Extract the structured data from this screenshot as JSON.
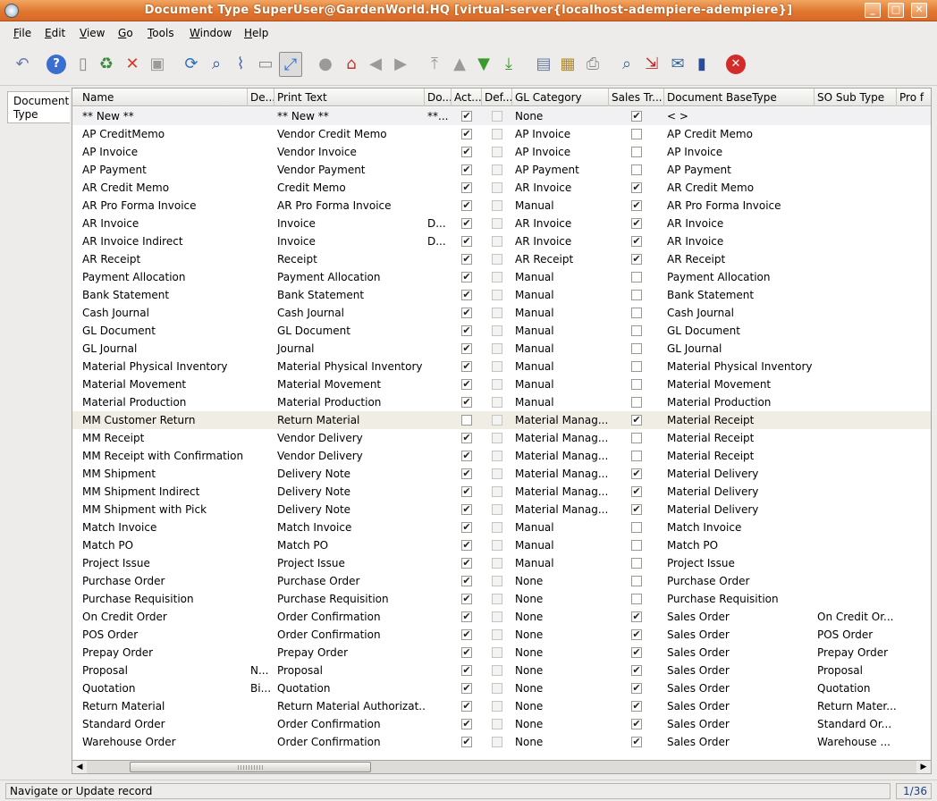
{
  "window": {
    "title": "Document Type  SuperUser@GardenWorld.HQ [virtual-server{localhost-adempiere-adempiere}]"
  },
  "menu": [
    "File",
    "Edit",
    "View",
    "Go",
    "Tools",
    "Window",
    "Help"
  ],
  "toolbar": [
    {
      "name": "undo-icon",
      "glyph": "↶",
      "color": "#6b7aa8"
    },
    {
      "name": "help-icon",
      "glyph": "?",
      "color": "#3a6ecf",
      "circle": true
    },
    {
      "name": "new-record-icon",
      "glyph": "▯",
      "color": "#888"
    },
    {
      "name": "copy-record-icon",
      "glyph": "♻",
      "color": "#3a8a3a"
    },
    {
      "name": "delete-icon",
      "glyph": "✕",
      "color": "#d13a2a"
    },
    {
      "name": "save-icon",
      "glyph": "▣",
      "color": "#9a9a9a"
    },
    {
      "name": "refresh-icon",
      "glyph": "⟳",
      "color": "#2a6fbf"
    },
    {
      "name": "find-icon",
      "glyph": "⌕",
      "color": "#2a5aa0"
    },
    {
      "name": "attachment-icon",
      "glyph": "⌇",
      "color": "#4a6ab0"
    },
    {
      "name": "chat-icon",
      "glyph": "▭",
      "color": "#888"
    },
    {
      "name": "grid-toggle-icon",
      "glyph": "⤢",
      "color": "#3a6ecf",
      "active": true
    },
    {
      "name": "history-icon",
      "glyph": "●",
      "color": "#9a9a9a"
    },
    {
      "name": "home-icon",
      "glyph": "⌂",
      "color": "#c0392b"
    },
    {
      "name": "parent-icon",
      "glyph": "◀",
      "color": "#9a9a9a"
    },
    {
      "name": "detail-icon",
      "glyph": "▶",
      "color": "#9a9a9a"
    },
    {
      "name": "first-record-icon",
      "glyph": "⤒",
      "color": "#9a9a9a"
    },
    {
      "name": "previous-record-icon",
      "glyph": "▲",
      "color": "#9a9a9a"
    },
    {
      "name": "next-record-icon",
      "glyph": "▼",
      "color": "#3a9a2a"
    },
    {
      "name": "last-record-icon",
      "glyph": "⤓",
      "color": "#3a9a2a"
    },
    {
      "name": "report-icon",
      "glyph": "▤",
      "color": "#6a7a9a"
    },
    {
      "name": "archive-icon",
      "glyph": "▦",
      "color": "#b08a2a"
    },
    {
      "name": "print-icon",
      "glyph": "⎙",
      "color": "#8a8a8a"
    },
    {
      "name": "zoom-across-icon",
      "glyph": "⌕",
      "color": "#3a6a9a"
    },
    {
      "name": "workflow-icon",
      "glyph": "⇲",
      "color": "#c02a2a"
    },
    {
      "name": "request-icon",
      "glyph": "✉",
      "color": "#3a6a9a"
    },
    {
      "name": "product-info-icon",
      "glyph": "▮",
      "color": "#2a4a9a"
    },
    {
      "name": "exit-icon",
      "glyph": "✕",
      "color": "#d32a2a",
      "circle": true
    }
  ],
  "tab": {
    "label": "Document Type"
  },
  "columns": [
    "Name",
    "De...",
    "Print Text",
    "Do...",
    "Act...",
    "Def...",
    "GL Category",
    "Sales Tr...",
    "Document BaseType",
    "SO Sub Type",
    "Pro f"
  ],
  "rows": [
    {
      "name": "** New **",
      "desc": "",
      "print": "** New **",
      "doc": "**...",
      "active": true,
      "def": false,
      "gl": "None",
      "sales": true,
      "base": "<  >",
      "sub": "",
      "new": true
    },
    {
      "name": "AP CreditMemo",
      "desc": "",
      "print": "Vendor Credit Memo",
      "doc": "",
      "active": true,
      "def": false,
      "gl": "AP Invoice",
      "sales": false,
      "base": "AP Credit Memo",
      "sub": ""
    },
    {
      "name": "AP Invoice",
      "desc": "",
      "print": "Vendor Invoice",
      "doc": "",
      "active": true,
      "def": false,
      "gl": "AP Invoice",
      "sales": false,
      "base": "AP Invoice",
      "sub": ""
    },
    {
      "name": "AP Payment",
      "desc": "",
      "print": "Vendor Payment",
      "doc": "",
      "active": true,
      "def": false,
      "gl": "AP Payment",
      "sales": false,
      "base": "AP Payment",
      "sub": ""
    },
    {
      "name": "AR Credit Memo",
      "desc": "",
      "print": "Credit Memo",
      "doc": "",
      "active": true,
      "def": false,
      "gl": "AR Invoice",
      "sales": true,
      "base": "AR Credit Memo",
      "sub": ""
    },
    {
      "name": "AR Pro Forma Invoice",
      "desc": "",
      "print": "AR Pro Forma Invoice",
      "doc": "",
      "active": true,
      "def": false,
      "gl": "Manual",
      "sales": true,
      "base": "AR Pro Forma Invoice",
      "sub": ""
    },
    {
      "name": "AR Invoice",
      "desc": "",
      "print": "Invoice",
      "doc": "D...",
      "active": true,
      "def": false,
      "gl": "AR Invoice",
      "sales": true,
      "base": "AR Invoice",
      "sub": ""
    },
    {
      "name": "AR Invoice Indirect",
      "desc": "",
      "print": "Invoice",
      "doc": "D...",
      "active": true,
      "def": false,
      "gl": "AR Invoice",
      "sales": true,
      "base": "AR Invoice",
      "sub": ""
    },
    {
      "name": "AR Receipt",
      "desc": "",
      "print": "Receipt",
      "doc": "",
      "active": true,
      "def": false,
      "gl": "AR Receipt",
      "sales": true,
      "base": "AR Receipt",
      "sub": ""
    },
    {
      "name": "Payment Allocation",
      "desc": "",
      "print": "Payment Allocation",
      "doc": "",
      "active": true,
      "def": false,
      "gl": "Manual",
      "sales": false,
      "base": "Payment Allocation",
      "sub": ""
    },
    {
      "name": "Bank Statement",
      "desc": "",
      "print": "Bank Statement",
      "doc": "",
      "active": true,
      "def": false,
      "gl": "Manual",
      "sales": false,
      "base": "Bank Statement",
      "sub": ""
    },
    {
      "name": "Cash Journal",
      "desc": "",
      "print": "Cash Journal",
      "doc": "",
      "active": true,
      "def": false,
      "gl": "Manual",
      "sales": false,
      "base": "Cash Journal",
      "sub": ""
    },
    {
      "name": "GL Document",
      "desc": "",
      "print": "GL Document",
      "doc": "",
      "active": true,
      "def": false,
      "gl": "Manual",
      "sales": false,
      "base": "GL Document",
      "sub": ""
    },
    {
      "name": "GL Journal",
      "desc": "",
      "print": "Journal",
      "doc": "",
      "active": true,
      "def": false,
      "gl": "Manual",
      "sales": false,
      "base": "GL Journal",
      "sub": ""
    },
    {
      "name": "Material Physical Inventory",
      "desc": "",
      "print": "Material Physical Inventory",
      "doc": "",
      "active": true,
      "def": false,
      "gl": "Manual",
      "sales": false,
      "base": "Material Physical Inventory",
      "sub": ""
    },
    {
      "name": "Material Movement",
      "desc": "",
      "print": "Material Movement",
      "doc": "",
      "active": true,
      "def": false,
      "gl": "Manual",
      "sales": false,
      "base": "Material Movement",
      "sub": ""
    },
    {
      "name": "Material Production",
      "desc": "",
      "print": "Material Production",
      "doc": "",
      "active": true,
      "def": false,
      "gl": "Manual",
      "sales": false,
      "base": "Material Production",
      "sub": ""
    },
    {
      "name": "MM Customer Return",
      "desc": "",
      "print": "Return Material",
      "doc": "",
      "active": false,
      "def": false,
      "gl": "Material Manag...",
      "sales": true,
      "base": "Material Receipt",
      "sub": "",
      "selected": true
    },
    {
      "name": "MM Receipt",
      "desc": "",
      "print": "Vendor Delivery",
      "doc": "",
      "active": true,
      "def": false,
      "gl": "Material Manag...",
      "sales": false,
      "base": "Material Receipt",
      "sub": ""
    },
    {
      "name": "MM Receipt with Confirmation",
      "desc": "",
      "print": "Vendor Delivery",
      "doc": "",
      "active": true,
      "def": false,
      "gl": "Material Manag...",
      "sales": false,
      "base": "Material Receipt",
      "sub": ""
    },
    {
      "name": "MM Shipment",
      "desc": "",
      "print": "Delivery Note",
      "doc": "",
      "active": true,
      "def": false,
      "gl": "Material Manag...",
      "sales": true,
      "base": "Material Delivery",
      "sub": ""
    },
    {
      "name": "MM Shipment Indirect",
      "desc": "",
      "print": "Delivery Note",
      "doc": "",
      "active": true,
      "def": false,
      "gl": "Material Manag...",
      "sales": true,
      "base": "Material Delivery",
      "sub": ""
    },
    {
      "name": "MM Shipment with Pick",
      "desc": "",
      "print": "Delivery Note",
      "doc": "",
      "active": true,
      "def": false,
      "gl": "Material Manag...",
      "sales": true,
      "base": "Material Delivery",
      "sub": ""
    },
    {
      "name": "Match Invoice",
      "desc": "",
      "print": "Match Invoice",
      "doc": "",
      "active": true,
      "def": false,
      "gl": "Manual",
      "sales": false,
      "base": "Match Invoice",
      "sub": ""
    },
    {
      "name": "Match PO",
      "desc": "",
      "print": "Match PO",
      "doc": "",
      "active": true,
      "def": false,
      "gl": "Manual",
      "sales": false,
      "base": "Match PO",
      "sub": ""
    },
    {
      "name": "Project Issue",
      "desc": "",
      "print": "Project Issue",
      "doc": "",
      "active": true,
      "def": false,
      "gl": "Manual",
      "sales": false,
      "base": "Project Issue",
      "sub": ""
    },
    {
      "name": "Purchase Order",
      "desc": "",
      "print": "Purchase Order",
      "doc": "",
      "active": true,
      "def": false,
      "gl": "None",
      "sales": false,
      "base": "Purchase Order",
      "sub": ""
    },
    {
      "name": "Purchase Requisition",
      "desc": "",
      "print": "Purchase Requisition",
      "doc": "",
      "active": true,
      "def": false,
      "gl": "None",
      "sales": false,
      "base": "Purchase Requisition",
      "sub": ""
    },
    {
      "name": "On Credit Order",
      "desc": "",
      "print": "Order Confirmation",
      "doc": "",
      "active": true,
      "def": false,
      "gl": "None",
      "sales": true,
      "base": "Sales Order",
      "sub": "On Credit Or..."
    },
    {
      "name": "POS Order",
      "desc": "",
      "print": "Order Confirmation",
      "doc": "",
      "active": true,
      "def": false,
      "gl": "None",
      "sales": true,
      "base": "Sales Order",
      "sub": "POS Order"
    },
    {
      "name": "Prepay Order",
      "desc": "",
      "print": "Prepay Order",
      "doc": "",
      "active": true,
      "def": false,
      "gl": "None",
      "sales": true,
      "base": "Sales Order",
      "sub": "Prepay Order"
    },
    {
      "name": "Proposal",
      "desc": "N...",
      "print": "Proposal",
      "doc": "",
      "active": true,
      "def": false,
      "gl": "None",
      "sales": true,
      "base": "Sales Order",
      "sub": "Proposal"
    },
    {
      "name": "Quotation",
      "desc": "Bi...",
      "print": "Quotation",
      "doc": "",
      "active": true,
      "def": false,
      "gl": "None",
      "sales": true,
      "base": "Sales Order",
      "sub": "Quotation"
    },
    {
      "name": "Return Material",
      "desc": "",
      "print": "Return Material Authorizat...",
      "doc": "",
      "active": true,
      "def": false,
      "gl": "None",
      "sales": true,
      "base": "Sales Order",
      "sub": "Return Mater..."
    },
    {
      "name": "Standard Order",
      "desc": "",
      "print": "Order Confirmation",
      "doc": "",
      "active": true,
      "def": false,
      "gl": "None",
      "sales": true,
      "base": "Sales Order",
      "sub": "Standard Or..."
    },
    {
      "name": "Warehouse Order",
      "desc": "",
      "print": "Order Confirmation",
      "doc": "",
      "active": true,
      "def": false,
      "gl": "None",
      "sales": true,
      "base": "Sales Order",
      "sub": "Warehouse ..."
    }
  ],
  "status": {
    "message": "Navigate or Update record",
    "record_count": "1/36"
  },
  "colors": {
    "titlebar": "#e0772f",
    "selected_row": "#efede4",
    "record_count": "#1a3e8a"
  }
}
